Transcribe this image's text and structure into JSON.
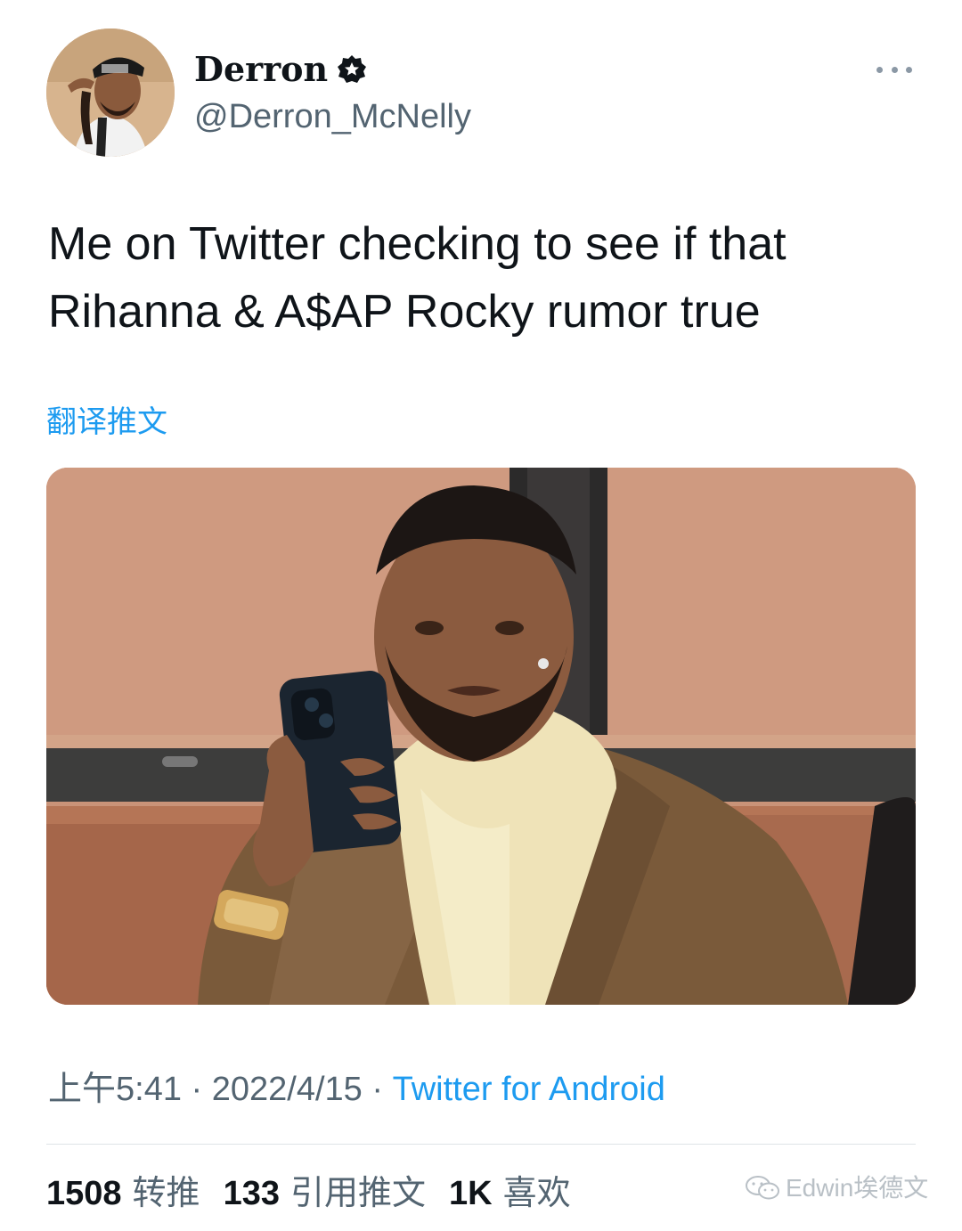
{
  "author": {
    "display_name": "Derron",
    "handle": "@Derron_McNelly",
    "avatar_icon": "user-avatar-photo",
    "verified_icon": "verified-badge-icon"
  },
  "tweet": {
    "text": "Me on Twitter checking to see if that Rihanna & A$AP Rocky rumor true",
    "translate_label": "翻译推文",
    "media_icon": "man-checking-phone-photo"
  },
  "meta": {
    "time": "上午5:41",
    "separator": " · ",
    "date": "2022/4/15",
    "source": "Twitter for Android"
  },
  "stats": {
    "retweets_count": "1508",
    "retweets_label": "转推",
    "quotes_count": "133",
    "quotes_label": "引用推文",
    "likes_count": "1K",
    "likes_label": "喜欢"
  },
  "watermark": {
    "text": "Edwin埃德文",
    "icon": "wechat-icon"
  },
  "colors": {
    "link": "#1d9bf0",
    "secondary_text": "#536471",
    "primary_text": "#0f1419"
  }
}
